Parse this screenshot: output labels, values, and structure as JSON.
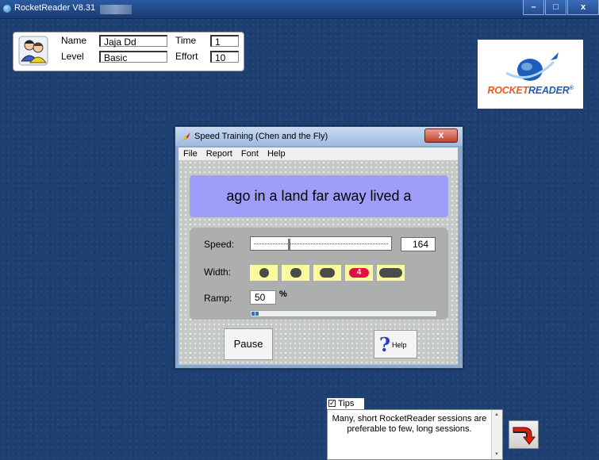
{
  "app": {
    "title": "RocketReader V8.31"
  },
  "window_controls": {
    "minimize": "–",
    "maximize": "□",
    "close": "x"
  },
  "user": {
    "name_label": "Name",
    "name_value": "Jaja Dd",
    "level_label": "Level",
    "level_value": "Basic",
    "time_label": "Time",
    "time_value": "1",
    "effort_label": "Effort",
    "effort_value": "10"
  },
  "logo": {
    "text_part1": "ROCKET",
    "text_part2": "READER",
    "mark": "®"
  },
  "dialog": {
    "title": "Speed Training (Chen and the Fly)",
    "close_label": "x",
    "menu": [
      "File",
      "Report",
      "Font",
      "Help"
    ],
    "display_text": "ago in a land far away lived a",
    "speed_label": "Speed:",
    "speed_value": "164",
    "speed_slider_fraction": 0.25,
    "width_label": "Width:",
    "width_options": [
      "1",
      "2",
      "3",
      "4",
      "5"
    ],
    "width_selected": "4",
    "ramp_label": "Ramp:",
    "ramp_value": "50",
    "ramp_unit": "%",
    "ramp_progress_fraction": 0.04,
    "pause_label": "Pause",
    "help_label": "Help"
  },
  "tips": {
    "checkbox_label": "Tips",
    "checked": true,
    "text": "Many, short RocketReader sessions are preferable to few, long sessions."
  },
  "colors": {
    "desktop": "#1e3f72",
    "display_bg": "#9e9efa",
    "width_btn": "#fafa9a",
    "width_active": "#e01040",
    "logo_orange": "#f05a1a",
    "logo_blue": "#1f5db8"
  },
  "icons": [
    "users-icon",
    "rocket-icon",
    "question-icon",
    "redo-arrow-icon"
  ]
}
